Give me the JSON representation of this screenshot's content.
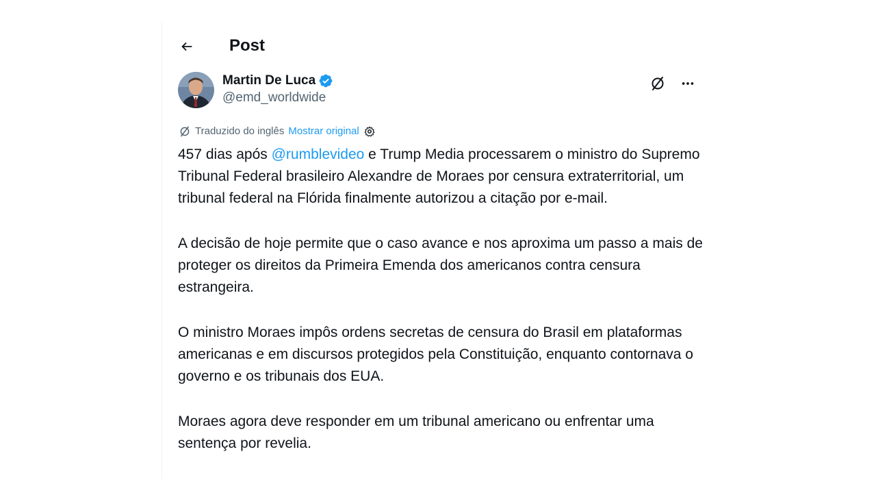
{
  "header": {
    "title": "Post"
  },
  "author": {
    "name": "Martin De Luca",
    "handle": "@emd_worldwide",
    "verified": true,
    "verified_color": "#1d9bf0"
  },
  "translation": {
    "note": "Traduzido do inglês",
    "show_original": "Mostrar original"
  },
  "post": {
    "p1": {
      "before": "457 dias após ",
      "mention": "@rumblevideo",
      "after": " e Trump Media processarem o ministro do Supremo Tribunal Federal brasileiro Alexandre de Moraes por censura extraterritorial, um tribunal federal na Flórida finalmente autorizou a citação por e-mail."
    },
    "p2": "A decisão de hoje permite que o caso avance e nos aproxima um passo a mais de proteger os direitos da Primeira Emenda dos americanos contra censura estrangeira.",
    "p3": "O ministro Moraes impôs ordens secretas de censura do Brasil em plataformas americanas e em discursos protegidos pela Constituição, enquanto contornava o governo e os tribunais dos EUA.",
    "p4": "Moraes agora deve responder em um tribunal americano ou enfrentar uma sentença por revelia."
  },
  "icons": {
    "back": "arrow-left-icon",
    "verified": "verified-badge-icon",
    "translate": "translate-icon",
    "more": "more-icon",
    "settings": "gear-icon"
  },
  "colors": {
    "text": "#0f1419",
    "secondary": "#536471",
    "link": "#1d9bf0"
  }
}
